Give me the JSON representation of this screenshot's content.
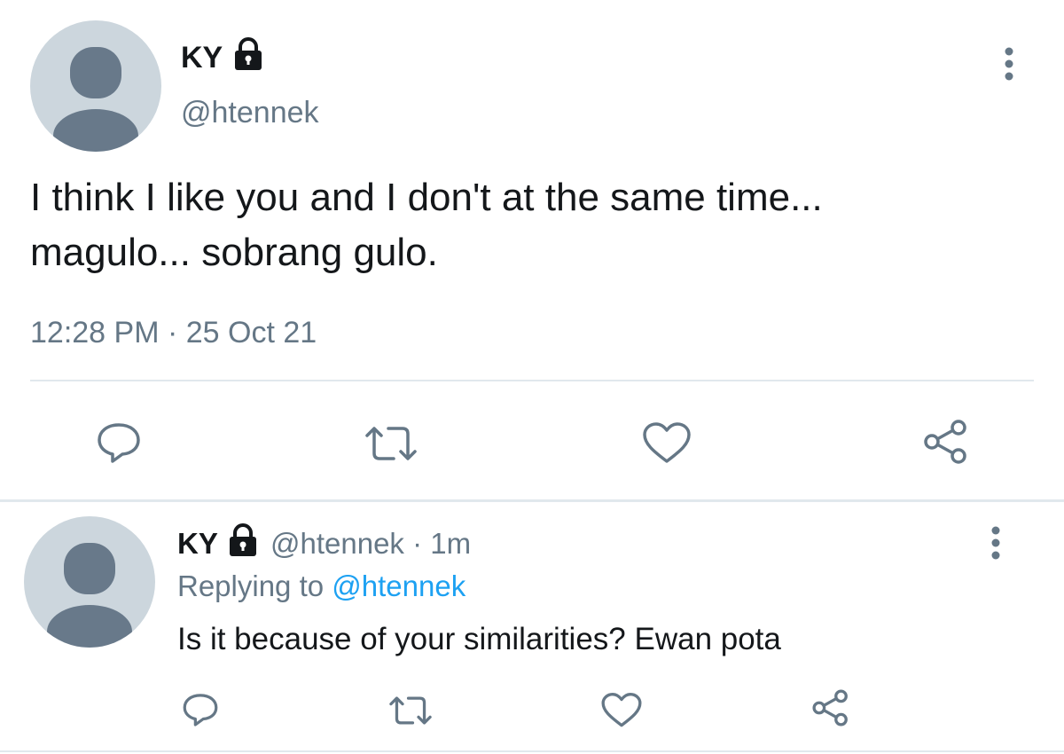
{
  "main_tweet": {
    "display_name": "KY",
    "handle": "@htennek",
    "text_line1": "I think I like you and I don't at the same time...",
    "text_line2": "magulo... sobrang gulo.",
    "timestamp": "12:28 PM · 25 Oct 21"
  },
  "reply_tweet": {
    "display_name": "KY",
    "handle_time": "@htennek · 1m",
    "replying_prefix": "Replying to ",
    "replying_handle": "@htennek",
    "text": "Is it because of your similarities? Ewan pota"
  },
  "icons": {
    "lock": "lock-icon",
    "more": "more-vertical-icon",
    "reply": "reply-icon",
    "retweet": "retweet-icon",
    "like": "heart-icon",
    "share": "share-icon"
  },
  "colors": {
    "text": "#14171a",
    "muted": "#657786",
    "link": "#1da1f2",
    "avatar_bg": "#ccd6dd",
    "avatar_fg": "#68798a",
    "divider": "#e1e8ed"
  }
}
